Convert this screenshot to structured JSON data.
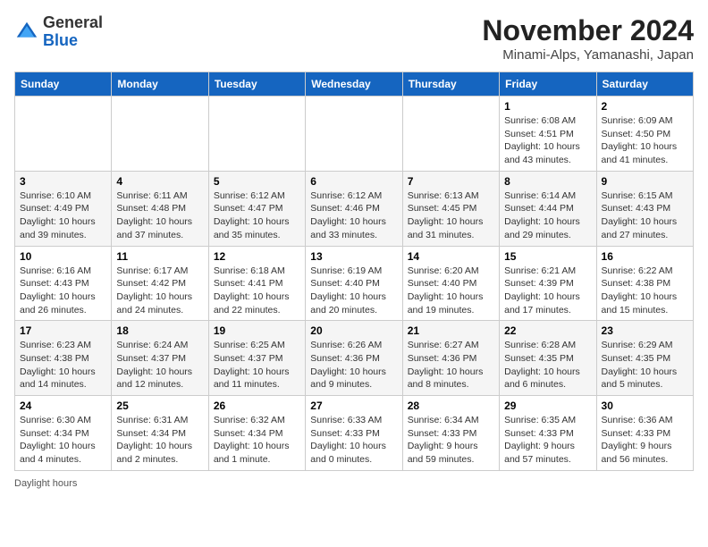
{
  "title": "November 2024",
  "subtitle": "Minami-Alps, Yamanashi, Japan",
  "logo": {
    "line1": "General",
    "line2": "Blue"
  },
  "days_of_week": [
    "Sunday",
    "Monday",
    "Tuesday",
    "Wednesday",
    "Thursday",
    "Friday",
    "Saturday"
  ],
  "footer": "Daylight hours",
  "weeks": [
    [
      {
        "day": "",
        "info": ""
      },
      {
        "day": "",
        "info": ""
      },
      {
        "day": "",
        "info": ""
      },
      {
        "day": "",
        "info": ""
      },
      {
        "day": "",
        "info": ""
      },
      {
        "day": "1",
        "info": "Sunrise: 6:08 AM\nSunset: 4:51 PM\nDaylight: 10 hours and 43 minutes."
      },
      {
        "day": "2",
        "info": "Sunrise: 6:09 AM\nSunset: 4:50 PM\nDaylight: 10 hours and 41 minutes."
      }
    ],
    [
      {
        "day": "3",
        "info": "Sunrise: 6:10 AM\nSunset: 4:49 PM\nDaylight: 10 hours and 39 minutes."
      },
      {
        "day": "4",
        "info": "Sunrise: 6:11 AM\nSunset: 4:48 PM\nDaylight: 10 hours and 37 minutes."
      },
      {
        "day": "5",
        "info": "Sunrise: 6:12 AM\nSunset: 4:47 PM\nDaylight: 10 hours and 35 minutes."
      },
      {
        "day": "6",
        "info": "Sunrise: 6:12 AM\nSunset: 4:46 PM\nDaylight: 10 hours and 33 minutes."
      },
      {
        "day": "7",
        "info": "Sunrise: 6:13 AM\nSunset: 4:45 PM\nDaylight: 10 hours and 31 minutes."
      },
      {
        "day": "8",
        "info": "Sunrise: 6:14 AM\nSunset: 4:44 PM\nDaylight: 10 hours and 29 minutes."
      },
      {
        "day": "9",
        "info": "Sunrise: 6:15 AM\nSunset: 4:43 PM\nDaylight: 10 hours and 27 minutes."
      }
    ],
    [
      {
        "day": "10",
        "info": "Sunrise: 6:16 AM\nSunset: 4:43 PM\nDaylight: 10 hours and 26 minutes."
      },
      {
        "day": "11",
        "info": "Sunrise: 6:17 AM\nSunset: 4:42 PM\nDaylight: 10 hours and 24 minutes."
      },
      {
        "day": "12",
        "info": "Sunrise: 6:18 AM\nSunset: 4:41 PM\nDaylight: 10 hours and 22 minutes."
      },
      {
        "day": "13",
        "info": "Sunrise: 6:19 AM\nSunset: 4:40 PM\nDaylight: 10 hours and 20 minutes."
      },
      {
        "day": "14",
        "info": "Sunrise: 6:20 AM\nSunset: 4:40 PM\nDaylight: 10 hours and 19 minutes."
      },
      {
        "day": "15",
        "info": "Sunrise: 6:21 AM\nSunset: 4:39 PM\nDaylight: 10 hours and 17 minutes."
      },
      {
        "day": "16",
        "info": "Sunrise: 6:22 AM\nSunset: 4:38 PM\nDaylight: 10 hours and 15 minutes."
      }
    ],
    [
      {
        "day": "17",
        "info": "Sunrise: 6:23 AM\nSunset: 4:38 PM\nDaylight: 10 hours and 14 minutes."
      },
      {
        "day": "18",
        "info": "Sunrise: 6:24 AM\nSunset: 4:37 PM\nDaylight: 10 hours and 12 minutes."
      },
      {
        "day": "19",
        "info": "Sunrise: 6:25 AM\nSunset: 4:37 PM\nDaylight: 10 hours and 11 minutes."
      },
      {
        "day": "20",
        "info": "Sunrise: 6:26 AM\nSunset: 4:36 PM\nDaylight: 10 hours and 9 minutes."
      },
      {
        "day": "21",
        "info": "Sunrise: 6:27 AM\nSunset: 4:36 PM\nDaylight: 10 hours and 8 minutes."
      },
      {
        "day": "22",
        "info": "Sunrise: 6:28 AM\nSunset: 4:35 PM\nDaylight: 10 hours and 6 minutes."
      },
      {
        "day": "23",
        "info": "Sunrise: 6:29 AM\nSunset: 4:35 PM\nDaylight: 10 hours and 5 minutes."
      }
    ],
    [
      {
        "day": "24",
        "info": "Sunrise: 6:30 AM\nSunset: 4:34 PM\nDaylight: 10 hours and 4 minutes."
      },
      {
        "day": "25",
        "info": "Sunrise: 6:31 AM\nSunset: 4:34 PM\nDaylight: 10 hours and 2 minutes."
      },
      {
        "day": "26",
        "info": "Sunrise: 6:32 AM\nSunset: 4:34 PM\nDaylight: 10 hours and 1 minute."
      },
      {
        "day": "27",
        "info": "Sunrise: 6:33 AM\nSunset: 4:33 PM\nDaylight: 10 hours and 0 minutes."
      },
      {
        "day": "28",
        "info": "Sunrise: 6:34 AM\nSunset: 4:33 PM\nDaylight: 9 hours and 59 minutes."
      },
      {
        "day": "29",
        "info": "Sunrise: 6:35 AM\nSunset: 4:33 PM\nDaylight: 9 hours and 57 minutes."
      },
      {
        "day": "30",
        "info": "Sunrise: 6:36 AM\nSunset: 4:33 PM\nDaylight: 9 hours and 56 minutes."
      }
    ]
  ]
}
